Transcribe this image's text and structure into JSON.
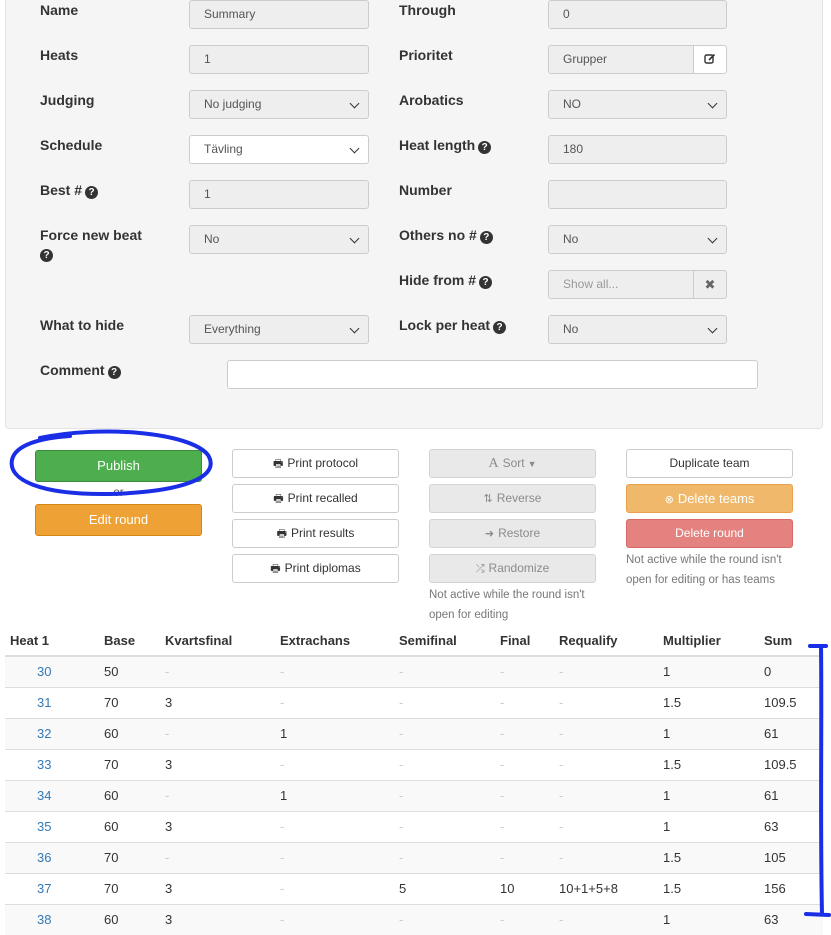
{
  "form": {
    "left": [
      {
        "label": "Name",
        "value": "Summary",
        "type": "text"
      },
      {
        "label": "Heats",
        "value": "1",
        "type": "text"
      },
      {
        "label": "Judging",
        "value": "No judging",
        "type": "select"
      },
      {
        "label": "Schedule",
        "value": "Tävling",
        "type": "select"
      },
      {
        "label": "Best #",
        "value": "1",
        "type": "text",
        "help": true
      },
      {
        "label": "Force new beat",
        "value": "No",
        "type": "select",
        "help": true
      },
      {
        "label": "What to hide",
        "value": "Everything",
        "type": "select"
      }
    ],
    "right": [
      {
        "label": "Through",
        "value": "0",
        "type": "text"
      },
      {
        "label": "Prioritet",
        "value": "Grupper",
        "type": "text-addon"
      },
      {
        "label": "Arobatics",
        "value": "NO",
        "type": "select"
      },
      {
        "label": "Heat length",
        "value": "180",
        "type": "text",
        "help": true
      },
      {
        "label": "Number",
        "value": "",
        "type": "text"
      },
      {
        "label": "Others no #",
        "value": "No",
        "type": "select",
        "help": true
      },
      {
        "label": "Hide from #",
        "placeholder": "Show all...",
        "type": "text-clear",
        "help": true
      },
      {
        "label": "Lock per heat",
        "value": "No",
        "type": "select",
        "help": true
      }
    ],
    "comment_label": "Comment",
    "comment_value": ""
  },
  "actions": {
    "publish": "Publish",
    "or": "-- or --",
    "edit_round": "Edit round",
    "print_protocol": "Print protocol",
    "print_recalled": "Print recalled",
    "print_results": "Print results",
    "print_diplomas": "Print diplomas",
    "sort": "Sort",
    "reverse": "Reverse",
    "restore": "Restore",
    "randomize": "Randomize",
    "sort_note": "Not active while the round isn't open for editing",
    "duplicate_team": "Duplicate team",
    "delete_teams": "Delete teams",
    "delete_round": "Delete round",
    "delete_note": "Not active while the round isn't open for editing or has teams"
  },
  "table": {
    "headers": [
      "Heat 1",
      "Base",
      "Kvartsfinal",
      "Extrachans",
      "Semifinal",
      "Final",
      "Requalify",
      "Multiplier",
      "Sum"
    ],
    "rows": [
      [
        "30",
        "50",
        "-",
        "-",
        "-",
        "-",
        "-",
        "1",
        "0"
      ],
      [
        "31",
        "70",
        "3",
        "-",
        "-",
        "-",
        "-",
        "1.5",
        "109.5"
      ],
      [
        "32",
        "60",
        "-",
        "1",
        "-",
        "-",
        "-",
        "1",
        "61"
      ],
      [
        "33",
        "70",
        "3",
        "-",
        "-",
        "-",
        "-",
        "1.5",
        "109.5"
      ],
      [
        "34",
        "60",
        "-",
        "1",
        "-",
        "-",
        "-",
        "1",
        "61"
      ],
      [
        "35",
        "60",
        "3",
        "-",
        "-",
        "-",
        "-",
        "1",
        "63"
      ],
      [
        "36",
        "70",
        "-",
        "-",
        "-",
        "-",
        "-",
        "1.5",
        "105"
      ],
      [
        "37",
        "70",
        "3",
        "-",
        "5",
        "10",
        "10+1+5+8",
        "1.5",
        "156"
      ],
      [
        "38",
        "60",
        "3",
        "-",
        "-",
        "-",
        "-",
        "1",
        "63"
      ]
    ]
  },
  "colors": {
    "annotation": "#1a2ee6",
    "link": "#337ab7",
    "success": "#4cae4c",
    "warning": "#eea236",
    "danger": "#d9534f"
  }
}
